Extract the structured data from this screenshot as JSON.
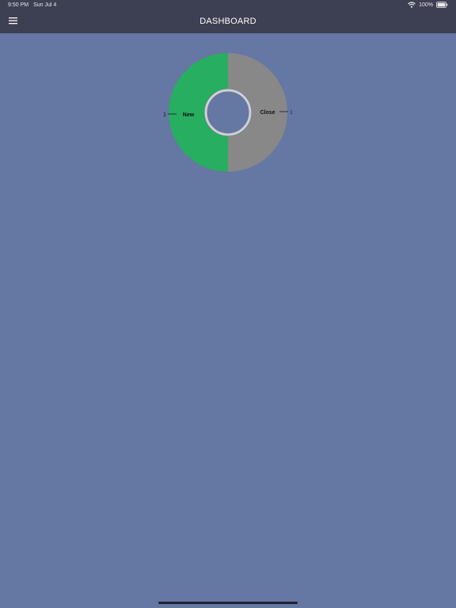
{
  "status_bar": {
    "time": "9:50 PM",
    "date": "Sun Jul 4",
    "battery": "100%",
    "icons": [
      "wifi-icon",
      "battery-icon"
    ]
  },
  "nav": {
    "title": "DASHBOARD",
    "menu_icon": "hamburger-menu-icon"
  },
  "colors": {
    "background": "#6577a3",
    "bar": "#3d3f52",
    "new": "#27ae60",
    "close": "#888888",
    "ring": "#d0d0d0"
  },
  "chart_data": {
    "type": "pie",
    "variant": "donut",
    "title": "",
    "slices": [
      {
        "label": "New",
        "value": 1,
        "value_label": "1",
        "color": "#27ae60"
      },
      {
        "label": "Close",
        "value": 1,
        "value_label": "1",
        "color": "#888888"
      }
    ]
  }
}
